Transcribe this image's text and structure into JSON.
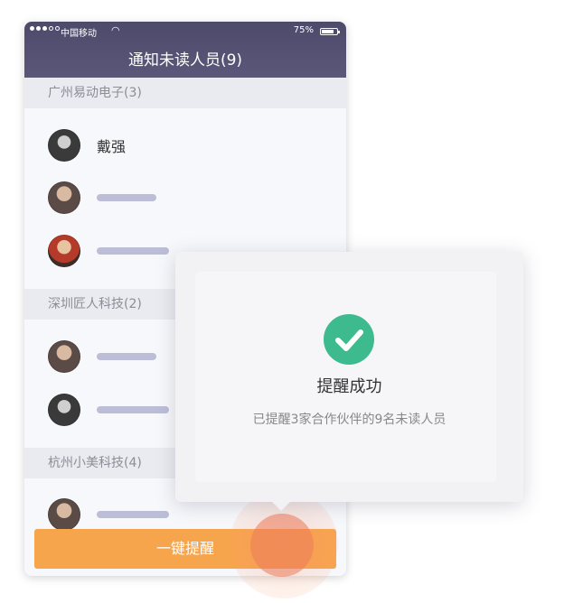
{
  "status_bar": {
    "carrier": "中国移动",
    "battery_text": "75%",
    "battery_level": 0.75,
    "wifi_icon": "wifi-icon"
  },
  "header": {
    "title": "通知未读人员(9)"
  },
  "groups": [
    {
      "label": "广州易动电子(3)",
      "members": [
        "戴强",
        "",
        ""
      ]
    },
    {
      "label": "深圳匠人科技(2)"
    },
    {
      "label": "杭州小美科技(4)"
    }
  ],
  "bottom_button": {
    "label": "一键提醒"
  },
  "popup": {
    "icon": "check-circle-icon",
    "icon_color": "#3dbb8e",
    "title": "提醒成功",
    "message": "已提醒3家合作伙伴的9名未读人员"
  },
  "colors": {
    "header": "#55517a",
    "button": "#f7a54c",
    "placeholder_bar": "#bcbdd7"
  }
}
